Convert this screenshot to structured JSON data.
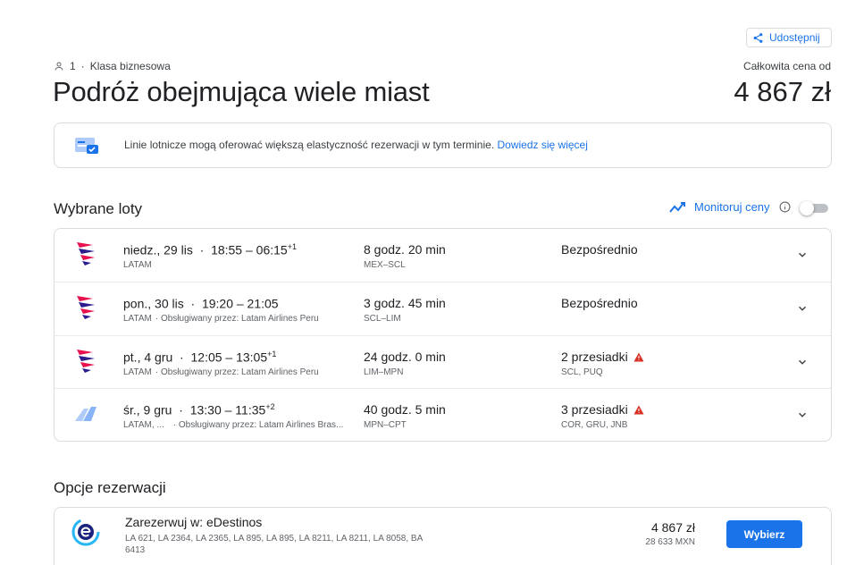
{
  "header": {
    "share_label": "Udostępnij",
    "passengers": "1",
    "separator": "·",
    "cabin_class": "Klasa biznesowa",
    "title": "Podróż obejmująca wiele miast",
    "total_label": "Całkowita cena od",
    "total_price": "4 867 zł"
  },
  "info_banner": {
    "text": "Linie lotnicze mogą oferować większą elastyczność rezerwacji w tym terminie.",
    "link": "Dowiedz się więcej"
  },
  "selected_flights": {
    "title": "Wybrane loty",
    "monitor_label": "Monitoruj ceny",
    "monitor_enabled": false,
    "flights": [
      {
        "date": "niedz., 29 lis",
        "dot": "·",
        "time": "18:55 – 06:15",
        "day_offset": "+1",
        "airline": "LATAM",
        "operator": "",
        "duration": "8 godz. 20 min",
        "route": "MEX–SCL",
        "stops": "Bezpośrednio",
        "stop_codes": "",
        "warning": false,
        "logo": "latam-logo-icon"
      },
      {
        "date": "pon., 30 lis",
        "dot": "·",
        "time": "19:20 – 21:05",
        "day_offset": "",
        "airline": "LATAM",
        "operator": "·  Obsługiwany przez: Latam Airlines Peru",
        "duration": "3 godz. 45 min",
        "route": "SCL–LIM",
        "stops": "Bezpośrednio",
        "stop_codes": "",
        "warning": false,
        "logo": "latam-logo-icon"
      },
      {
        "date": "pt., 4 gru",
        "dot": "·",
        "time": "12:05 – 13:05",
        "day_offset": "+1",
        "airline": "LATAM",
        "operator": "·  Obsługiwany przez: Latam Airlines Peru",
        "duration": "24 godz. 0 min",
        "route": "LIM–MPN",
        "stops": "2 przesiadki",
        "stop_codes": "SCL, PUQ",
        "warning": true,
        "logo": "latam-logo-icon"
      },
      {
        "date": "śr., 9 gru",
        "dot": "·",
        "time": "13:30 – 11:35",
        "day_offset": "+2",
        "airline": "LATAM, ...",
        "operator": "·  Obsługiwany przez: Latam Airlines Bras...",
        "duration": "40 godz. 5 min",
        "route": "MPN–CPT",
        "stops": "3 przesiadki",
        "stop_codes": "COR, GRU, JNB",
        "warning": true,
        "logo": "multi-airline-tail-icon"
      }
    ]
  },
  "booking_options": {
    "title": "Opcje rezerwacji",
    "options": [
      {
        "provider": "Zarezerwuj w: eDestinos",
        "flight_numbers": "LA 621, LA 2364, LA 2365, LA 895, LA 895, LA 8211, LA 8211, LA 8058, BA 6413",
        "price": "4 867 zł",
        "price_alt": "28 633 MXN",
        "select_label": "Wybierz"
      }
    ]
  },
  "colors": {
    "accent": "#1a73e8",
    "warning": "#d93025",
    "latam_indigo": "#2d1c8f",
    "latam_coral": "#e8114b"
  }
}
